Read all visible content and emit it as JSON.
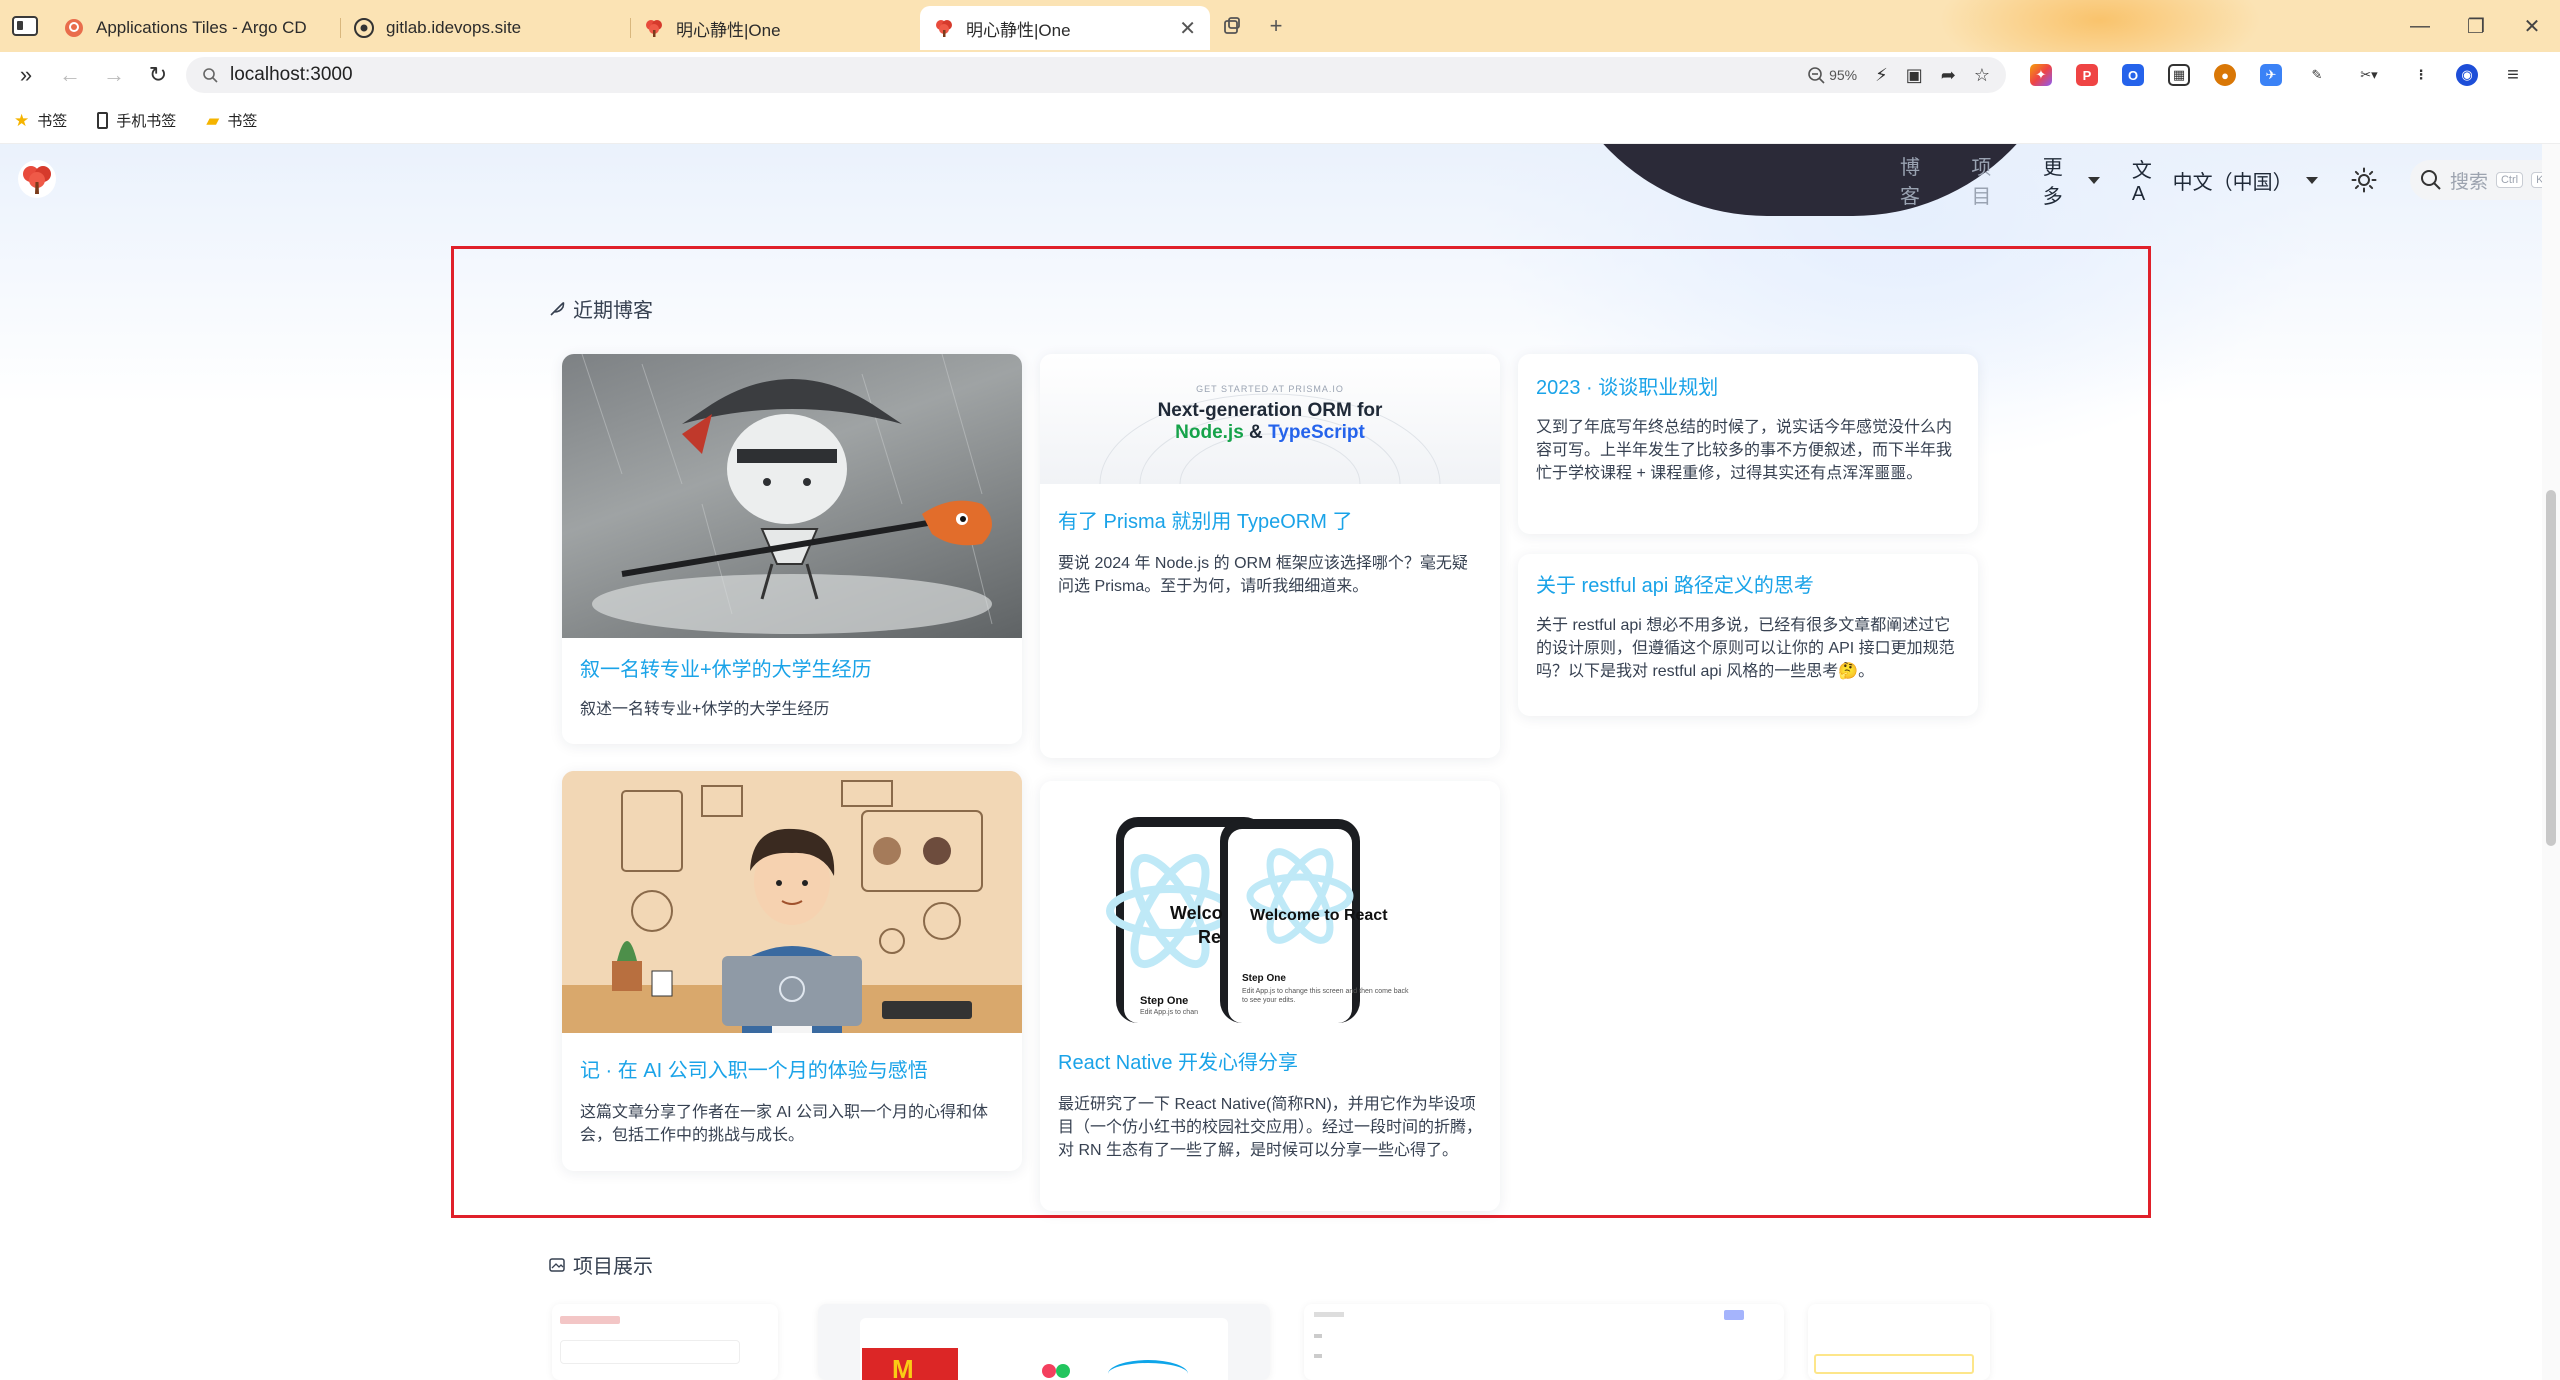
{
  "browser": {
    "tabs": [
      {
        "title": "Applications Tiles - Argo CD",
        "active": false
      },
      {
        "title": "gitlab.idevops.site",
        "active": false
      },
      {
        "title": "明心静性|One",
        "active": false
      },
      {
        "title": "明心静性|One",
        "active": true
      }
    ],
    "url": "localhost:3000",
    "zoom": "95%",
    "bookmarks": [
      "书签",
      "手机书签",
      "书签"
    ]
  },
  "site": {
    "nav": {
      "blog": "博客",
      "project": "项目",
      "more": "更多",
      "language": "中文（中国）",
      "search_placeholder": "搜索",
      "kbd_ctrl": "Ctrl",
      "kbd_k": "K"
    },
    "recent_blogs": {
      "title": "近期博客",
      "posts": [
        {
          "title": "叙一名转专业+休学的大学生经历",
          "desc": "叙述一名转专业+休学的大学生经历"
        },
        {
          "title": "有了 Prisma 就别用 TypeORM 了",
          "desc": "要说 2024 年 Node.js 的 ORM 框架应该选择哪个？毫无疑问选 Prisma。至于为何，请听我细细道来。",
          "image_caption": "GET STARTED AT PRISMA.IO",
          "image_line1": "Next-generation ORM for",
          "image_node": "Node.js",
          "image_amp": "&",
          "image_ts": "TypeScript"
        },
        {
          "title": "2023 · 谈谈职业规划",
          "desc": "又到了年底写年终总结的时候了，说实话今年感觉没什么内容可写。上半年发生了比较多的事不方便叙述，而下半年我忙于学校课程 + 课程重修，过得其实还有点浑浑噩噩。"
        },
        {
          "title": "关于 restful api 路径定义的思考",
          "desc": "关于 restful api 想必不用多说，已经有很多文章都阐述过它的设计原则，但遵循这个原则可以让你的 API 接口更加规范吗？以下是我对 restful api 风格的一些思考🤔。"
        },
        {
          "title": "记 · 在 AI 公司入职一个月的体验与感悟",
          "desc": "这篇文章分享了作者在一家 AI 公司入职一个月的心得和体会，包括工作中的挑战与成长。"
        },
        {
          "title": "React Native 开发心得分享",
          "desc": "最近研究了一下 React Native(简称RN)，并用它作为毕设项目（一个仿小红书的校园社交应用）。经过一段时间的折腾，对 RN 生态有了一些了解，是时候可以分享一些心得了。",
          "image_welcome": "Welcome to React",
          "image_welcome_partial1": "Welco",
          "image_welcome_partial2": "Re",
          "image_step": "Step One",
          "image_step_desc": "Edit App.js to change this screen and then come back to see your edits.",
          "image_step_desc_partial": "Edit App.js to chan"
        }
      ]
    },
    "projects": {
      "title": "项目展示"
    }
  },
  "colors": {
    "accent": "#1aa3e8",
    "highlight_border": "#e0202a",
    "tabbar": "#fbe3b4",
    "prisma_green": "#16a34a",
    "prisma_blue": "#2563eb"
  },
  "icons": [
    "sidebar-toggle-icon",
    "argo-icon",
    "github-icon",
    "tree-logo-icon",
    "close-icon",
    "plus-icon",
    "back-icon",
    "forward-icon",
    "reload-icon",
    "search-icon",
    "star-icon",
    "folder-icon",
    "feather-icon",
    "gallery-icon",
    "translate-icon",
    "sun-icon"
  ]
}
